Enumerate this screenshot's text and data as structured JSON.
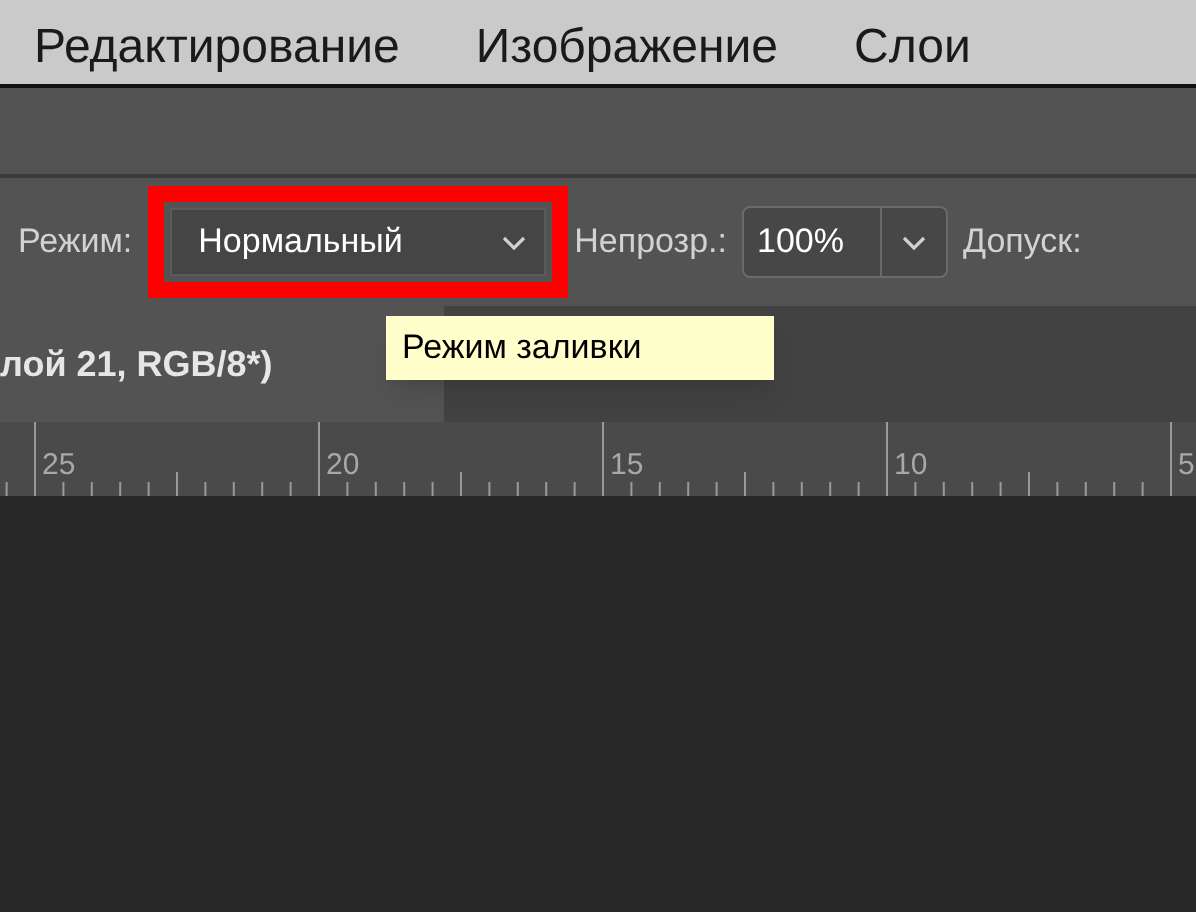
{
  "menu_bar": {
    "items": [
      "Редактирование",
      "Изображение",
      "Слои"
    ]
  },
  "options_bar": {
    "mode_label": "Режим:",
    "mode_dropdown": {
      "value": "Нормальный",
      "highlighted": true
    },
    "opacity_label": "Непрозр.:",
    "opacity_field": {
      "value": "100%"
    },
    "tolerance_label": "Допуск:"
  },
  "tooltip": {
    "text": "Режим заливки"
  },
  "document_tab": {
    "title": "лой 21, RGB/8*)"
  },
  "ruler": {
    "labels": [
      "25",
      "20",
      "15",
      "10",
      "5"
    ]
  }
}
